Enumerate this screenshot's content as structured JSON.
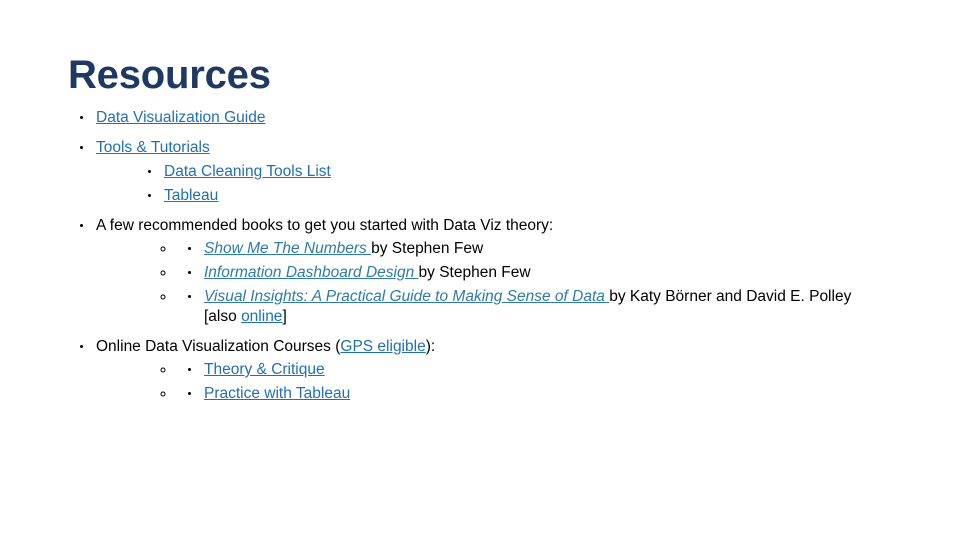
{
  "slide": {
    "title": "Resources",
    "title_color": "#1F3864",
    "background_color": "#FFFFFF",
    "link_color": "#1F6FB5",
    "book_link_color": "#2E7BA6",
    "text_color": "#000000"
  },
  "bullets": {
    "data_viz_guide": "Data Visualization Guide",
    "tools_tutorials": "Tools & Tutorials",
    "data_cleaning_tools_list": "Data Cleaning Tools List",
    "tableau": "Tableau",
    "books_intro": "A few recommended books to get you started with Data Viz theory:",
    "book1_title": "Show Me The Numbers ",
    "book1_author": "by Stephen Few",
    "book2_title": "Information Dashboard Design ",
    "book2_author": "by Stephen Few",
    "book3_title": "Visual Insights: A Practical Guide to Making Sense of Data ",
    "book3_author": "by Katy Börner and David E. Polley",
    "book3_also_open": "[also ",
    "book3_also_link": "online",
    "book3_also_close": "]",
    "courses_intro_pre": "Online Data Visualization Courses (",
    "courses_intro_link": "GPS eligible",
    "courses_intro_post": "):",
    "course1": "Theory & Critique",
    "course2": "Practice with Tableau"
  }
}
